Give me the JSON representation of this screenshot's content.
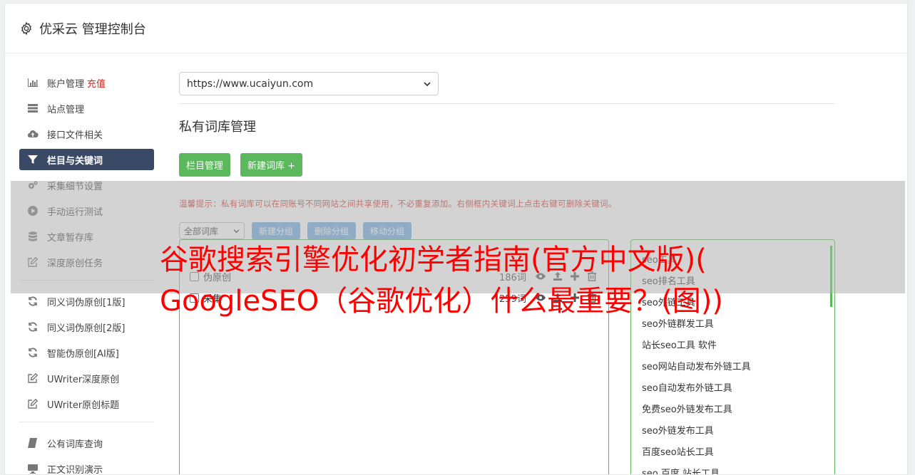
{
  "header": {
    "title": "优采云 管理控制台",
    "icon": "gear-icon"
  },
  "sidebar": {
    "items": [
      {
        "label": "账户管理",
        "badge": "充值",
        "icon": "bar-chart-icon"
      },
      {
        "label": "站点管理",
        "icon": "server-icon"
      },
      {
        "label": "接口文件相关",
        "icon": "cloud-upload-icon"
      },
      {
        "label": "栏目与关键词",
        "icon": "filter-icon",
        "active": true
      },
      {
        "label": "采集细节设置",
        "icon": "cogs-icon"
      },
      {
        "label": "手动运行测试",
        "icon": "play-circle-icon"
      },
      {
        "label": "文章暂存库",
        "icon": "database-icon"
      },
      {
        "label": "深度原创任务",
        "icon": "edit-icon"
      },
      {
        "label": "同义词伪原创[1版]",
        "icon": "refresh-icon"
      },
      {
        "label": "同义词伪原创[2版]",
        "icon": "refresh-icon"
      },
      {
        "label": "智能伪原创[AI版]",
        "icon": "refresh-icon"
      },
      {
        "label": "UWriter深度原创",
        "icon": "edit-icon"
      },
      {
        "label": "UWriter原创标题",
        "icon": "edit-icon"
      },
      {
        "label": "公有词库查询",
        "icon": "book-icon"
      },
      {
        "label": "正文识别演示",
        "icon": "monitor-icon"
      }
    ]
  },
  "main": {
    "site_select": "https://www.ucaiyun.com",
    "section_title": "私有词库管理",
    "btn_columns": "栏目管理",
    "btn_new_lib": "新建词库 +",
    "tip": "温馨提示：私有词库可以在同账号不同网站之间共享使用，不必重复添加。右侧框内关键词上点击右键可删除关键词。",
    "lib_filter": "全部词库",
    "btn_new_group": "新建分组",
    "btn_delete_group": "删除分组",
    "btn_move_group": "移动分组",
    "libraries": [
      {
        "name": "伪原创",
        "count": "186词"
      },
      {
        "name": "采集",
        "count": "259词"
      }
    ],
    "keywords": [
      "seo工具",
      "seo排名工具",
      "seo外链工具",
      "seo外链群发工具",
      "站长seo工具 软件",
      "seo网站自动发布外链工具",
      "seo自动发布外链工具",
      "免费seo外链发布工具",
      "seo外链发布工具",
      "百度seo站长工具",
      "seo 百度 站长工具"
    ]
  },
  "overlay": {
    "line1": "谷歌搜索引擎优化初学者指南(官方中文版)(",
    "line2": "GoogleSEO（谷歌优化）什么最重要？(图))"
  }
}
